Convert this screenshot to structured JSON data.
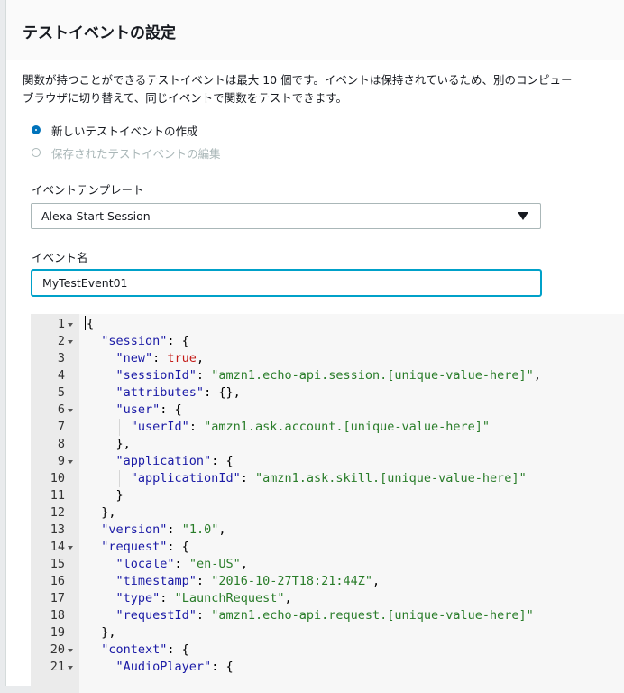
{
  "modal": {
    "title": "テストイベントの設定",
    "description_line1": "関数が持つことができるテストイベントは最大 10 個です。イベントは保持されているため、別のコンピュー",
    "description_line2": "ブラウザに切り替えて、同じイベントで関数をテストできます。"
  },
  "radios": [
    {
      "label": "新しいテストイベントの作成",
      "selected": true,
      "enabled": true
    },
    {
      "label": "保存されたテストイベントの編集",
      "selected": false,
      "enabled": false
    }
  ],
  "template": {
    "label": "イベントテンプレート",
    "selected": "Alexa Start Session"
  },
  "event_name": {
    "label": "イベント名",
    "value": "MyTestEvent01"
  },
  "editor": {
    "lines": [
      {
        "n": "1",
        "fold": true,
        "html": "{"
      },
      {
        "n": "2",
        "fold": true,
        "html": "  <span class=\"k\">\"session\"</span>: {"
      },
      {
        "n": "3",
        "fold": false,
        "html": "    <span class=\"k\">\"new\"</span>: <span class=\"b\">true</span>,"
      },
      {
        "n": "4",
        "fold": false,
        "html": "    <span class=\"k\">\"sessionId\"</span>: <span class=\"s\">\"amzn1.echo-api.session.[unique-value-here]\"</span>,"
      },
      {
        "n": "5",
        "fold": false,
        "html": "    <span class=\"k\">\"attributes\"</span>: {},"
      },
      {
        "n": "6",
        "fold": true,
        "html": "    <span class=\"k\">\"user\"</span>: {"
      },
      {
        "n": "7",
        "fold": false,
        "html": "      <span class=\"k\">\"userId\"</span>: <span class=\"s\">\"amzn1.ask.account.[unique-value-here]\"</span>"
      },
      {
        "n": "8",
        "fold": false,
        "html": "    },"
      },
      {
        "n": "9",
        "fold": true,
        "html": "    <span class=\"k\">\"application\"</span>: {"
      },
      {
        "n": "10",
        "fold": false,
        "html": "      <span class=\"k\">\"applicationId\"</span>: <span class=\"s\">\"amzn1.ask.skill.[unique-value-here]\"</span>"
      },
      {
        "n": "11",
        "fold": false,
        "html": "    }"
      },
      {
        "n": "12",
        "fold": false,
        "html": "  },"
      },
      {
        "n": "13",
        "fold": false,
        "html": "  <span class=\"k\">\"version\"</span>: <span class=\"s\">\"1.0\"</span>,"
      },
      {
        "n": "14",
        "fold": true,
        "html": "  <span class=\"k\">\"request\"</span>: {"
      },
      {
        "n": "15",
        "fold": false,
        "html": "    <span class=\"k\">\"locale\"</span>: <span class=\"s\">\"en-US\"</span>,"
      },
      {
        "n": "16",
        "fold": false,
        "html": "    <span class=\"k\">\"timestamp\"</span>: <span class=\"s\">\"2016-10-27T18:21:44Z\"</span>,"
      },
      {
        "n": "17",
        "fold": false,
        "html": "    <span class=\"k\">\"type\"</span>: <span class=\"s\">\"LaunchRequest\"</span>,"
      },
      {
        "n": "18",
        "fold": false,
        "html": "    <span class=\"k\">\"requestId\"</span>: <span class=\"s\">\"amzn1.echo-api.request.[unique-value-here]\"</span>"
      },
      {
        "n": "19",
        "fold": false,
        "html": "  },"
      },
      {
        "n": "20",
        "fold": true,
        "html": "  <span class=\"k\">\"context\"</span>: {"
      },
      {
        "n": "21",
        "fold": true,
        "html": "    <span class=\"k\">\"AudioPlayer\"</span>: {"
      }
    ]
  }
}
